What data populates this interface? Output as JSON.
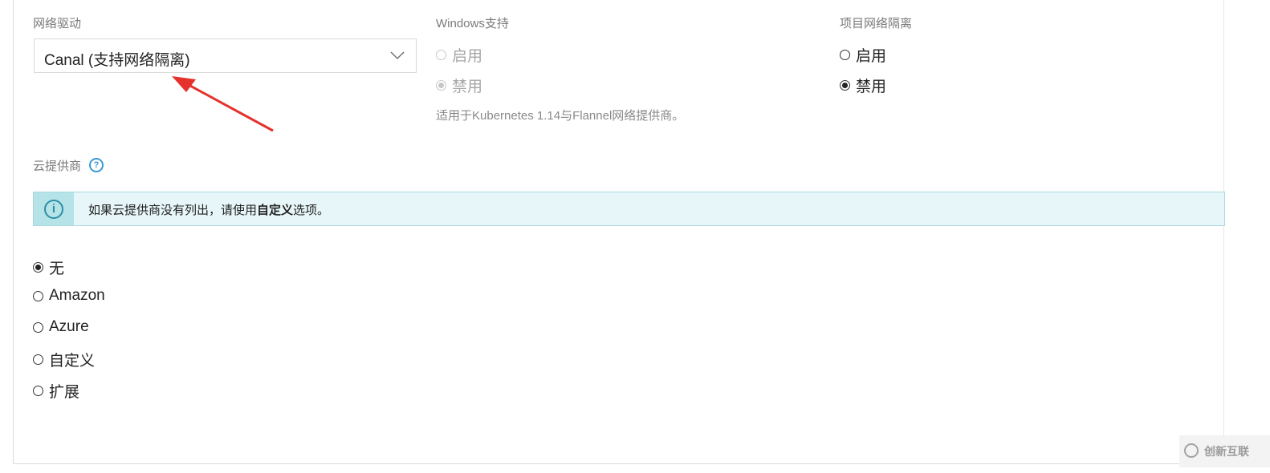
{
  "network_driver": {
    "label": "网络驱动",
    "selected": "Canal (支持网络隔离)"
  },
  "windows_support": {
    "label": "Windows支持",
    "options": [
      "启用",
      "禁用"
    ],
    "selected": "禁用",
    "disabled": true,
    "help": "适用于Kubernetes 1.14与Flannel网络提供商。"
  },
  "project_isolation": {
    "label": "项目网络隔离",
    "options": [
      "启用",
      "禁用"
    ],
    "selected": "禁用"
  },
  "cloud_provider": {
    "label": "云提供商",
    "help_icon": "?",
    "banner": {
      "icon": "i",
      "text_before": "如果云提供商没有列出，请使用",
      "text_bold": "自定义",
      "text_after": "选项。"
    },
    "options": [
      "无",
      "Amazon",
      "Azure",
      "自定义",
      "扩展"
    ],
    "selected": "无"
  },
  "annotation": {
    "arrow_color": "#e5322d"
  },
  "watermark": {
    "text": "创新互联"
  }
}
